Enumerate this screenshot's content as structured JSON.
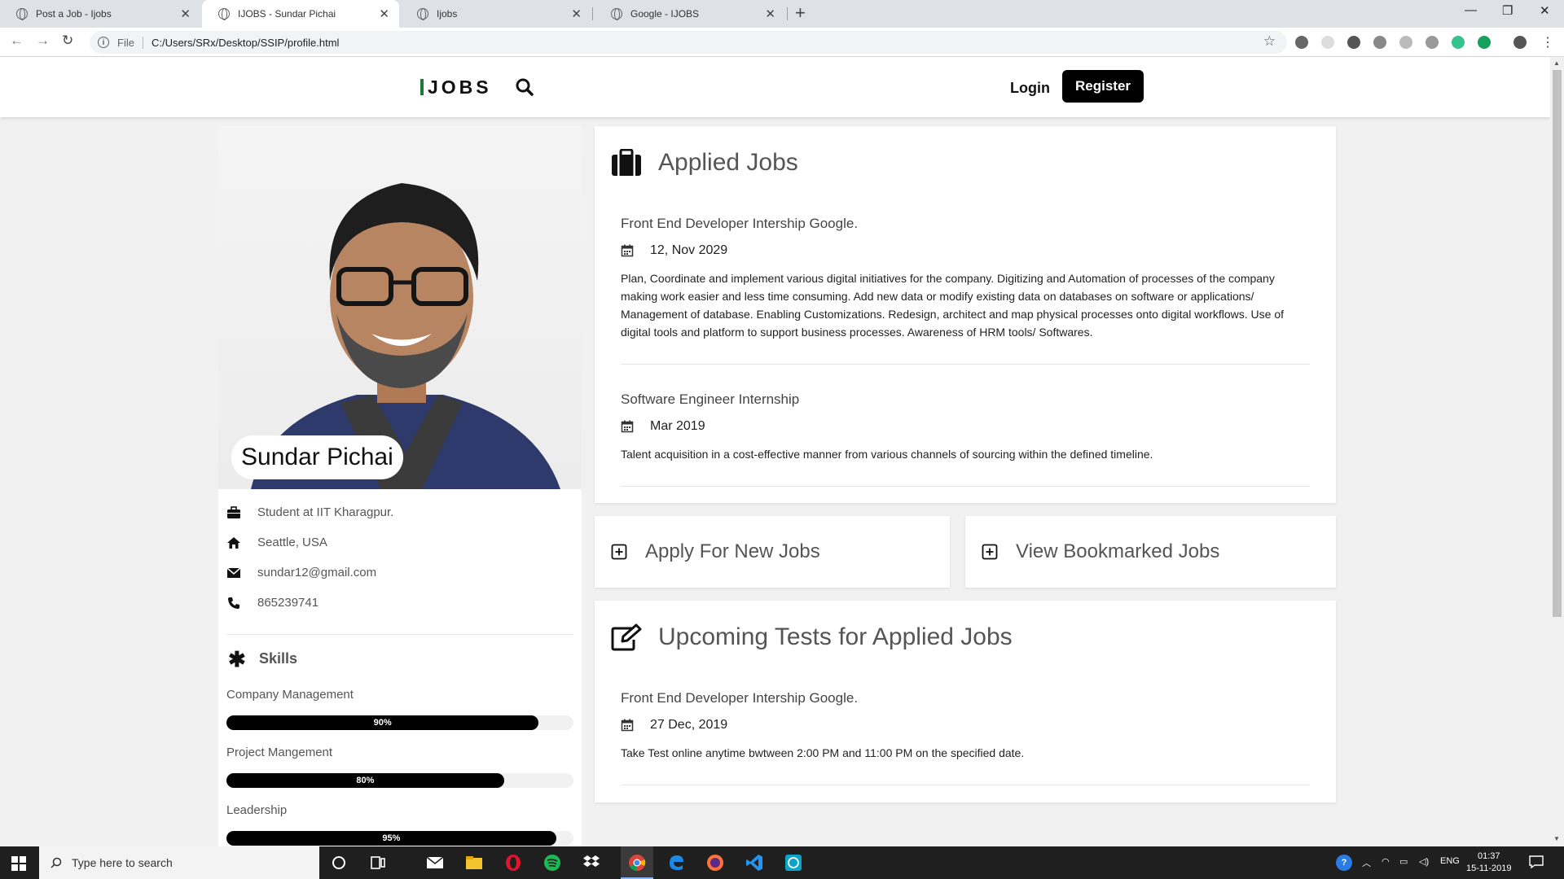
{
  "browser": {
    "tabs": [
      {
        "title": "Post a Job - Ijobs",
        "active": false
      },
      {
        "title": "IJOBS - Sundar Pichai",
        "active": true
      },
      {
        "title": "Ijobs",
        "active": false
      },
      {
        "title": "Google - IJOBS",
        "active": false
      }
    ],
    "address": {
      "scheme_label": "File",
      "url": "C:/Users/SRx/Desktop/SSIP/profile.html"
    }
  },
  "header": {
    "logo": "JOBS",
    "login": "Login",
    "register": "Register"
  },
  "profile": {
    "name": "Sundar Pichai",
    "info": {
      "occupation": "Student at IIT Kharagpur.",
      "location": "Seattle, USA",
      "email": "sundar12@gmail.com",
      "phone": "865239741"
    },
    "skills_title": "Skills",
    "skills": [
      {
        "name": "Company Management",
        "percent": 90,
        "label": "90%"
      },
      {
        "name": "Project Mangement",
        "percent": 80,
        "label": "80%"
      },
      {
        "name": "Leadership",
        "percent": 95,
        "label": "95%"
      }
    ]
  },
  "applied_jobs": {
    "title": "Applied Jobs",
    "jobs": [
      {
        "title": "Front End Developer Intership Google.",
        "date": "12, Nov 2029",
        "description": "Plan, Coordinate and implement various digital initiatives for the company. Digitizing and Automation of processes of the company making work easier and less time consuming. Add new data or modify existing data on databases on software or applications/ Management of database. Enabling Customizations. Redesign, architect and map physical processes onto digital workflows. Use of digital tools and platform to support business processes. Awareness of HRM tools/ Softwares."
      },
      {
        "title": "Software Engineer Internship",
        "date": "Mar 2019",
        "description": "Talent acquisition in a cost-effective manner from various channels of sourcing within the defined timeline."
      }
    ]
  },
  "actions": {
    "apply": "Apply For New Jobs",
    "bookmarked": "View Bookmarked Jobs"
  },
  "upcoming_tests": {
    "title": "Upcoming Tests for Applied Jobs",
    "tests": [
      {
        "title": "Front End Developer Intership Google.",
        "date": "27 Dec, 2019",
        "description": "Take Test online anytime bwtween 2:00 PM and 11:00 PM on the specified date."
      }
    ]
  },
  "taskbar": {
    "search_placeholder": "Type here to search",
    "lang": "ENG",
    "time": "01:37",
    "date": "15-11-2019"
  },
  "colors": {
    "brand_accent": "#1b7a3b",
    "primary_button": "#000000"
  }
}
